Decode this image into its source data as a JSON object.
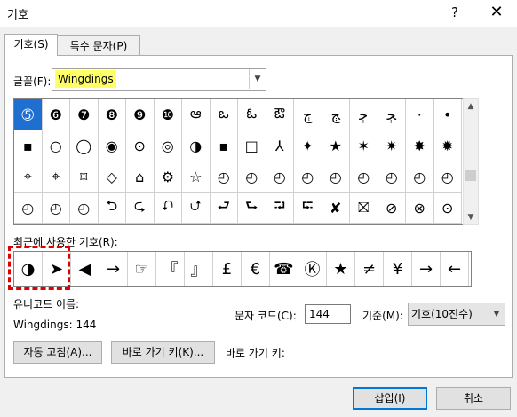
{
  "window": {
    "title": "기호",
    "help_label": "?",
    "close_label": "✕"
  },
  "tabs": [
    {
      "label": "기호(S)"
    },
    {
      "label": "특수 문자(P)"
    }
  ],
  "font": {
    "label": "글꼴(F):",
    "value": "Wingdings"
  },
  "grid_rows": [
    [
      "➄",
      "❻",
      "❼",
      "❽",
      "❾",
      "❿",
      "ఆ",
      "ఒ",
      "ఓ",
      "ఔ",
      "ﭲ",
      "ﭳ",
      "ﭴ",
      "ﭵ",
      "·",
      "•"
    ],
    [
      "▪",
      "○",
      "◯",
      "◉",
      "⊙",
      "◎",
      "◑",
      "▪",
      "□",
      "⅄",
      "✦",
      "★",
      "✶",
      "✷",
      "✸",
      "✹"
    ],
    [
      "⌖",
      "⌖",
      "⌑",
      "◇",
      "⌂",
      "⚙",
      "☆",
      "◴",
      "◴",
      "◴",
      "◴",
      "◴",
      "◴",
      "◴",
      "◴",
      "◴"
    ],
    [
      "◴",
      "◴",
      "◴",
      "⮌",
      "⮎",
      "⮏",
      "⮍",
      "⮐",
      "⮑",
      "⮒",
      "⮓",
      "✘",
      "⛝",
      "⊘",
      "⊗",
      "⊙"
    ]
  ],
  "recent": {
    "label": "최근에 사용한 기호(R):",
    "symbols": [
      "◑",
      "➤",
      "◀",
      "→",
      "☞",
      "『",
      "』",
      "£",
      "€",
      "☎",
      "Ⓚ",
      "★",
      "≠",
      "¥",
      "→",
      "←"
    ]
  },
  "unicode_name": {
    "label": "유니코드 이름:",
    "value": "Wingdings: 144"
  },
  "char_code": {
    "label": "문자 코드(C):",
    "value": "144"
  },
  "basis": {
    "label": "기준(M):",
    "value": "기호(10진수)"
  },
  "buttons": {
    "autocorrect": "자동 고침(A)...",
    "shortcut_key": "바로 가기 키(K)...",
    "shortcut_label": "바로 가기 키:",
    "insert": "삽입(I)",
    "cancel": "취소"
  }
}
